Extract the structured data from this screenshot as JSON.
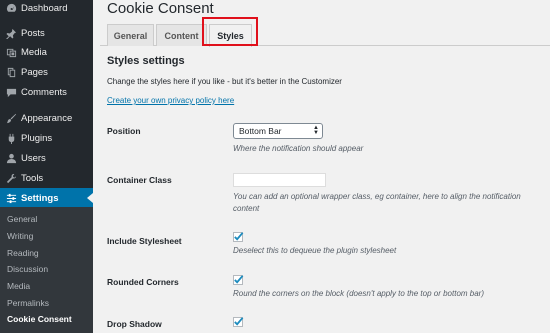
{
  "sidebar": {
    "items": [
      {
        "label": "Dashboard",
        "icon": "dashboard-icon"
      },
      {
        "label": "Posts",
        "icon": "pin-icon"
      },
      {
        "label": "Media",
        "icon": "media-icon"
      },
      {
        "label": "Pages",
        "icon": "pages-icon"
      },
      {
        "label": "Comments",
        "icon": "comment-icon"
      },
      {
        "label": "Appearance",
        "icon": "brush-icon"
      },
      {
        "label": "Plugins",
        "icon": "plug-icon"
      },
      {
        "label": "Users",
        "icon": "user-icon"
      },
      {
        "label": "Tools",
        "icon": "wrench-icon"
      },
      {
        "label": "Settings",
        "icon": "settings-icon"
      }
    ],
    "submenu": [
      "General",
      "Writing",
      "Reading",
      "Discussion",
      "Media",
      "Permalinks",
      "Cookie Consent"
    ]
  },
  "page": {
    "title": "Cookie Consent",
    "tabs": [
      "General",
      "Content",
      "Styles"
    ],
    "section_title": "Styles settings",
    "intro": "Change the styles here if you like - but it's better in the Customizer",
    "policy_link": "Create your own privacy policy here"
  },
  "settings": {
    "position": {
      "label": "Position",
      "value": "Bottom Bar",
      "desc": "Where the notification should appear"
    },
    "container_class": {
      "label": "Container Class",
      "value": "",
      "desc": "You can add an optional wrapper class, eg container, here to align the notification content"
    },
    "include_stylesheet": {
      "label": "Include Stylesheet",
      "checked": true,
      "desc": "Deselect this to dequeue the plugin stylesheet"
    },
    "rounded_corners": {
      "label": "Rounded Corners",
      "checked": true,
      "desc": "Round the corners on the block (doesn't apply to the top or bottom bar)"
    },
    "drop_shadow": {
      "label": "Drop Shadow",
      "checked": true
    }
  },
  "colors": {
    "sidebar_bg": "#23282d",
    "accent": "#0073aa",
    "highlight": "#e0101b"
  }
}
